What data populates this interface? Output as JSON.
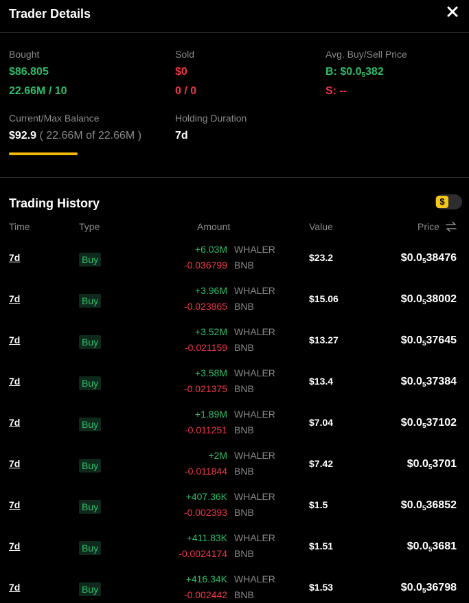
{
  "header": {
    "title": "Trader Details"
  },
  "stats": {
    "bought": {
      "label": "Bought",
      "usd": "$86.805",
      "detail": "22.66M / 10"
    },
    "sold": {
      "label": "Sold",
      "usd": "$0",
      "detail": "0 / 0"
    },
    "avg_price": {
      "label": "Avg. Buy/Sell Price",
      "buy_prefix": "B: $0.0",
      "buy_sub": "5",
      "buy_rest": "382",
      "sell": "S: --"
    },
    "balance": {
      "label": "Current/Max Balance",
      "usd": "$92.9",
      "detail": "( 22.66M of 22.66M )",
      "fill_fraction": 1.0
    },
    "holding": {
      "label": "Holding Duration",
      "value": "7d"
    }
  },
  "history": {
    "title": "Trading History",
    "toggle_symbol": "$",
    "columns": {
      "time": "Time",
      "type": "Type",
      "amount": "Amount",
      "value": "Value",
      "price": "Price"
    },
    "rows": [
      {
        "time": "7d",
        "type": "Buy",
        "amount_token": "+6.03M",
        "token": "WHALER",
        "amount_base": "-0.036799",
        "base": "BNB",
        "value": "$23.2",
        "price_prefix": "$0.0",
        "price_sub": "5",
        "price_rest": "38476"
      },
      {
        "time": "7d",
        "type": "Buy",
        "amount_token": "+3.96M",
        "token": "WHALER",
        "amount_base": "-0.023965",
        "base": "BNB",
        "value": "$15.06",
        "price_prefix": "$0.0",
        "price_sub": "5",
        "price_rest": "38002"
      },
      {
        "time": "7d",
        "type": "Buy",
        "amount_token": "+3.52M",
        "token": "WHALER",
        "amount_base": "-0.021159",
        "base": "BNB",
        "value": "$13.27",
        "price_prefix": "$0.0",
        "price_sub": "5",
        "price_rest": "37645"
      },
      {
        "time": "7d",
        "type": "Buy",
        "amount_token": "+3.58M",
        "token": "WHALER",
        "amount_base": "-0.021375",
        "base": "BNB",
        "value": "$13.4",
        "price_prefix": "$0.0",
        "price_sub": "5",
        "price_rest": "37384"
      },
      {
        "time": "7d",
        "type": "Buy",
        "amount_token": "+1.89M",
        "token": "WHALER",
        "amount_base": "-0.011251",
        "base": "BNB",
        "value": "$7.04",
        "price_prefix": "$0.0",
        "price_sub": "5",
        "price_rest": "37102"
      },
      {
        "time": "7d",
        "type": "Buy",
        "amount_token": "+2M",
        "token": "WHALER",
        "amount_base": "-0.011844",
        "base": "BNB",
        "value": "$7.42",
        "price_prefix": "$0.0",
        "price_sub": "5",
        "price_rest": "3701"
      },
      {
        "time": "7d",
        "type": "Buy",
        "amount_token": "+407.36K",
        "token": "WHALER",
        "amount_base": "-0.002393",
        "base": "BNB",
        "value": "$1.5",
        "price_prefix": "$0.0",
        "price_sub": "5",
        "price_rest": "36852"
      },
      {
        "time": "7d",
        "type": "Buy",
        "amount_token": "+411.83K",
        "token": "WHALER",
        "amount_base": "-0.0024174",
        "base": "BNB",
        "value": "$1.51",
        "price_prefix": "$0.0",
        "price_sub": "5",
        "price_rest": "3681"
      },
      {
        "time": "7d",
        "type": "Buy",
        "amount_token": "+416.34K",
        "token": "WHALER",
        "amount_base": "-0.002442",
        "base": "BNB",
        "value": "$1.53",
        "price_prefix": "$0.0",
        "price_sub": "5",
        "price_rest": "36798"
      }
    ]
  },
  "colors": {
    "buy": "#2ebd6b",
    "sell": "#f0364a",
    "accent": "#f3b800",
    "background": "#000000"
  },
  "icons": {
    "close": "close-icon",
    "swap": "swap-arrows-icon",
    "toggle": "dollar-icon"
  }
}
